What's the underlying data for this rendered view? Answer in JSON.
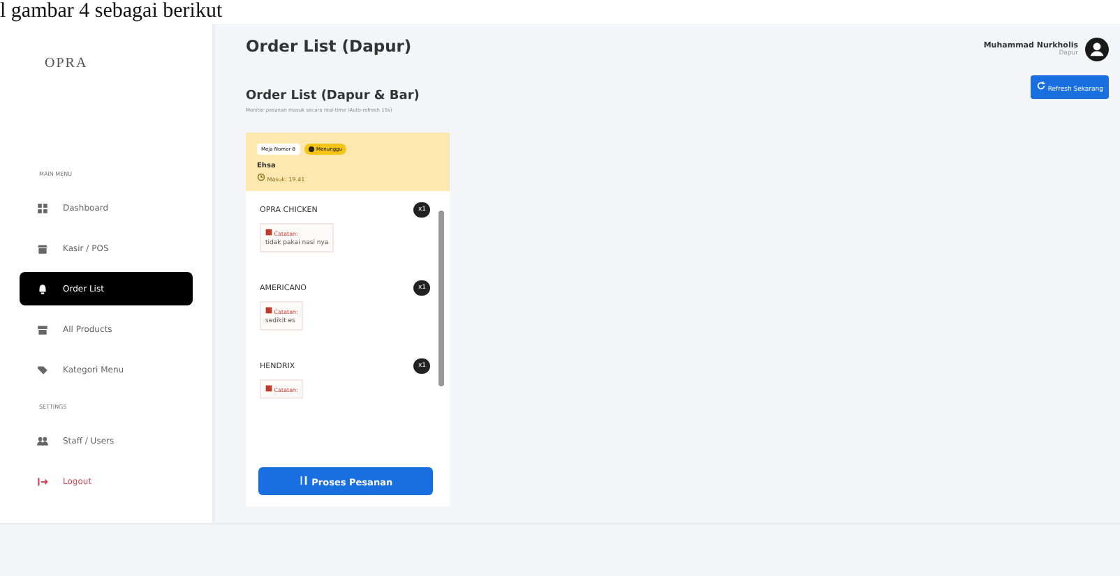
{
  "document_text": "l gambar 4 sebagai berikut",
  "sidebar": {
    "logo": "OPRA",
    "sections": [
      {
        "title": "MAIN MENU",
        "items": [
          {
            "label": "Dashboard",
            "selected": false,
            "kind": "normal"
          },
          {
            "label": "Kasir / POS",
            "selected": false,
            "kind": "normal"
          },
          {
            "label": "Order List",
            "selected": true,
            "kind": "normal"
          },
          {
            "label": "All Products",
            "selected": false,
            "kind": "normal"
          },
          {
            "label": "Kategori Menu",
            "selected": false,
            "kind": "normal"
          }
        ]
      },
      {
        "title": "SETTINGS",
        "items": [
          {
            "label": "Staff / Users",
            "selected": false,
            "kind": "normal"
          },
          {
            "label": "Logout",
            "selected": false,
            "kind": "danger"
          }
        ]
      }
    ]
  },
  "header": {
    "title": "Order List (Dapur)",
    "user_name": "Muhammad Nurkholis",
    "user_role": "Dapur"
  },
  "content": {
    "title": "Order List (Dapur & Bar)",
    "subtitle": "Monitor pesanan masuk secara real-time (Auto-refresh 15s)",
    "refresh_button": "Refresh Sekarang"
  },
  "orders": [
    {
      "table": "Meja Nomor 8",
      "status": "Menunggu",
      "customer": "Ehsa",
      "time": "Masuk: 19.41",
      "items": [
        {
          "name": "OPRA CHICKEN",
          "qty": "x1",
          "note_label": "Catatan:",
          "note": "tidak pakai nasi nya"
        },
        {
          "name": "AMERICANO",
          "qty": "x1",
          "note_label": "Catatan:",
          "note": "sedikit es"
        },
        {
          "name": "HENDRIX",
          "qty": "x1",
          "note_label": "Catatan:"
        }
      ],
      "action": "Proses Pesanan"
    }
  ]
}
